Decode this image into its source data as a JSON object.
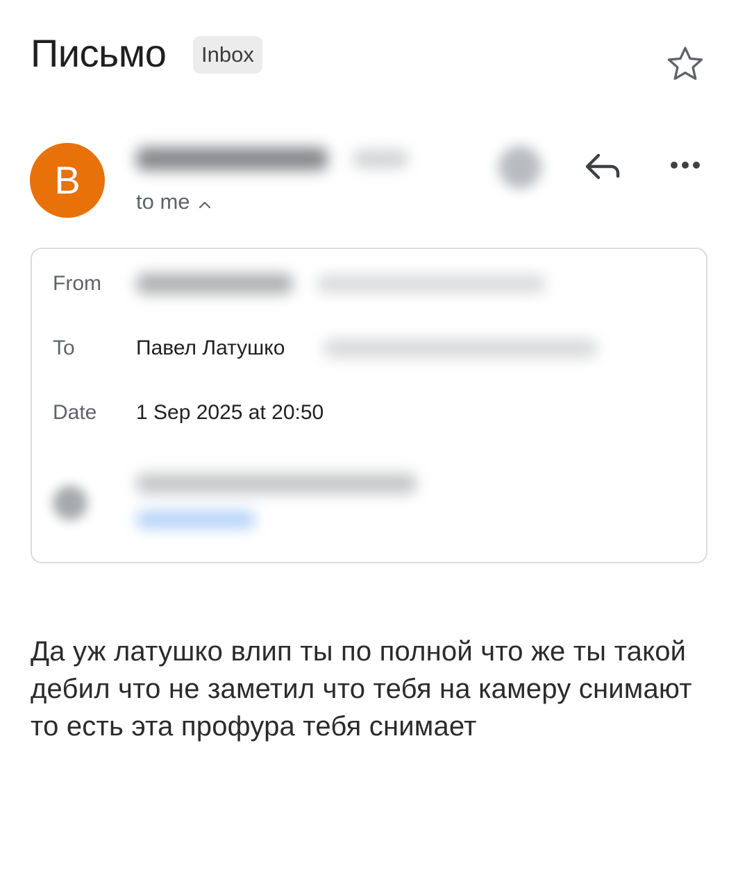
{
  "header": {
    "subject": "Письмо",
    "label": "Inbox",
    "star_icon": "star-outline-icon"
  },
  "sender": {
    "avatar_letter": "B",
    "avatar_color": "#e8710a",
    "recipient_summary": "to me",
    "reply_icon": "reply-icon",
    "more_icon": "more-horizontal-icon"
  },
  "details": {
    "from_label": "From",
    "to_label": "To",
    "to_name": "Павел Латушко",
    "date_label": "Date",
    "date_value": "1 Sep 2025 at 20:50"
  },
  "message": {
    "body": "Да уж латушко влип ты по полной что же ты такой дебил что не заметил что тебя на камеру снимают то есть эта профура тебя снимает"
  }
}
